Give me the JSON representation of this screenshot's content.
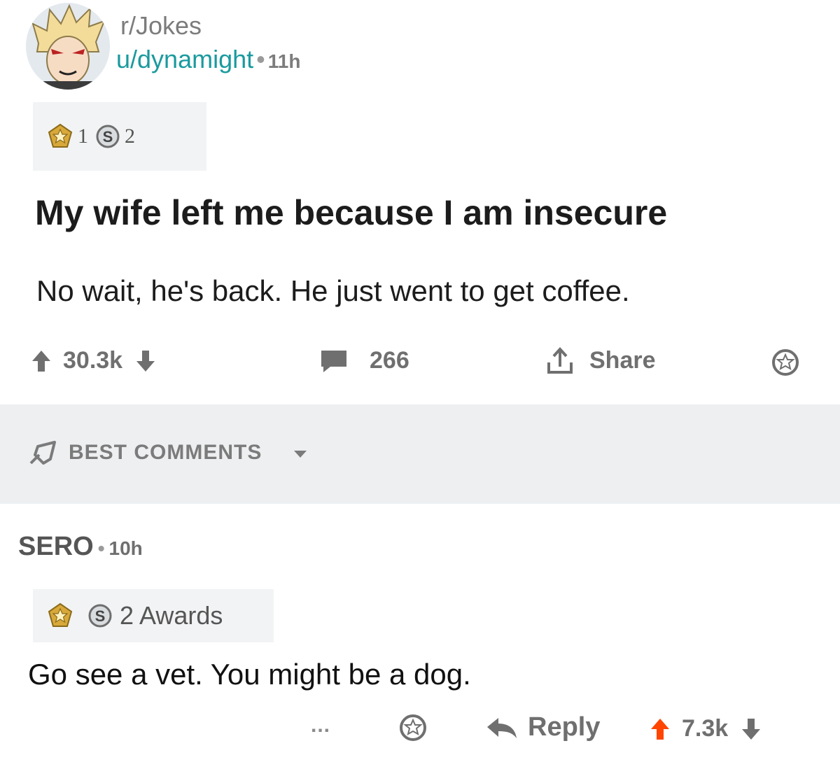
{
  "post": {
    "subreddit": "r/Jokes",
    "author": "u/dynamight",
    "separator": "•",
    "age": "11h",
    "awards": {
      "gold_count": "1",
      "silver_count": "2"
    },
    "title": "My wife left me because I am insecure",
    "body": "No wait, he's back. He just went to get coffee.",
    "actions": {
      "score": "30.3k",
      "comments": "266",
      "share_label": "Share"
    }
  },
  "sort": {
    "label": "BEST COMMENTS"
  },
  "comment": {
    "author": "SERO",
    "separator": "•",
    "age": "10h",
    "awards_label": "2 Awards",
    "body": "Go see a vet. You might be a dog.",
    "more_label": "...",
    "reply_label": "Reply",
    "score": "7.3k"
  },
  "colors": {
    "username": "#1a9a9e",
    "upvote": "#ff4500",
    "muted": "#6f6f6f",
    "sort_bar": "#edeff1"
  },
  "icons": [
    "avatar",
    "gold-award-icon",
    "silver-award-icon",
    "upvote-icon",
    "downvote-icon",
    "comment-icon",
    "share-icon",
    "save-icon",
    "rocket-icon",
    "caret-down-icon",
    "reply-icon"
  ]
}
